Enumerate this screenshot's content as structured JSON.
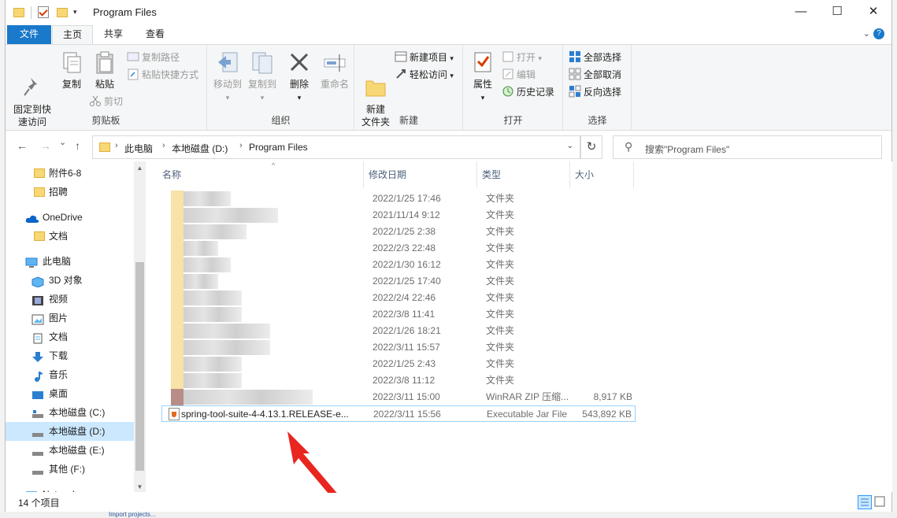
{
  "quick_access": {
    "dropdown": "▾"
  },
  "window": {
    "title": "Program Files",
    "minimize": "—",
    "maximize": "☐",
    "close": "✕"
  },
  "tabs": {
    "file": "文件",
    "home": "主页",
    "share": "共享",
    "view": "查看"
  },
  "ribbon": {
    "clipboard": {
      "pin": "固定到快\n速访问",
      "copy": "复制",
      "paste": "粘贴",
      "copy_path": "复制路径",
      "paste_shortcut": "粘贴快捷方式",
      "cut": "剪切",
      "label": "剪贴板"
    },
    "organize": {
      "move_to": "移动到",
      "copy_to": "复制到",
      "delete": "删除",
      "rename": "重命名",
      "label": "组织"
    },
    "new": {
      "new_folder": "新建\n文件夹",
      "new_item": "新建项目",
      "easy_access": "轻松访问",
      "label": "新建"
    },
    "open": {
      "properties": "属性",
      "open": "打开",
      "edit": "编辑",
      "history": "历史记录",
      "label": "打开"
    },
    "select": {
      "select_all": "全部选择",
      "select_none": "全部取消",
      "invert": "反向选择",
      "label": "选择"
    }
  },
  "nav": {
    "back": "←",
    "forward": "→",
    "up": "↑",
    "recent": "⌄",
    "refresh": "↻",
    "breadcrumb": [
      "此电脑",
      "本地磁盘 (D:)",
      "Program Files"
    ],
    "search_placeholder": "搜索\"Program Files\""
  },
  "sidebar": {
    "items": [
      {
        "label": "附件6-8",
        "icon": "folder-icon"
      },
      {
        "label": "招聘",
        "icon": "folder-icon"
      },
      {
        "label": "OneDrive",
        "icon": "cloud-icon"
      },
      {
        "label": "文档",
        "icon": "folder-icon"
      },
      {
        "label": "此电脑",
        "icon": "computer-icon"
      },
      {
        "label": "3D 对象",
        "icon": "cube-icon"
      },
      {
        "label": "视频",
        "icon": "video-icon"
      },
      {
        "label": "图片",
        "icon": "picture-icon"
      },
      {
        "label": "文档",
        "icon": "document-icon"
      },
      {
        "label": "下载",
        "icon": "download-icon"
      },
      {
        "label": "音乐",
        "icon": "music-icon"
      },
      {
        "label": "桌面",
        "icon": "desktop-icon"
      },
      {
        "label": "本地磁盘 (C:)",
        "icon": "drive-icon"
      },
      {
        "label": "本地磁盘 (D:)",
        "icon": "drive-icon"
      },
      {
        "label": "本地磁盘 (E:)",
        "icon": "drive-icon"
      },
      {
        "label": "其他 (F:)",
        "icon": "drive-icon"
      },
      {
        "label": "Network",
        "icon": "network-icon"
      }
    ]
  },
  "columns": {
    "name": "名称",
    "modified": "修改日期",
    "type": "类型",
    "size": "大小"
  },
  "files": [
    {
      "name": "",
      "date": "2022/1/25 17:46",
      "type": "文件夹",
      "size": ""
    },
    {
      "name": "",
      "date": "2021/11/14 9:12",
      "type": "文件夹",
      "size": ""
    },
    {
      "name": "",
      "date": "2022/1/25 2:38",
      "type": "文件夹",
      "size": ""
    },
    {
      "name": "",
      "date": "2022/2/3 22:48",
      "type": "文件夹",
      "size": ""
    },
    {
      "name": "",
      "date": "2022/1/30 16:12",
      "type": "文件夹",
      "size": ""
    },
    {
      "name": "",
      "date": "2022/1/25 17:40",
      "type": "文件夹",
      "size": ""
    },
    {
      "name": "",
      "date": "2022/2/4 22:46",
      "type": "文件夹",
      "size": ""
    },
    {
      "name": "",
      "date": "2022/3/8 11:41",
      "type": "文件夹",
      "size": ""
    },
    {
      "name": "",
      "date": "2022/1/26 18:21",
      "type": "文件夹",
      "size": ""
    },
    {
      "name": "",
      "date": "2022/3/11 15:57",
      "type": "文件夹",
      "size": ""
    },
    {
      "name": "",
      "date": "2022/1/25 2:43",
      "type": "文件夹",
      "size": ""
    },
    {
      "name": "",
      "date": "2022/3/8 11:12",
      "type": "文件夹",
      "size": ""
    },
    {
      "name": "",
      "date": "2022/3/11 15:00",
      "type": "WinRAR ZIP 压缩...",
      "size": "8,917 KB"
    },
    {
      "name": "spring-tool-suite-4-4.13.1.RELEASE-e...",
      "date": "2022/3/11 15:56",
      "type": "Executable Jar File",
      "size": "543,892 KB"
    }
  ],
  "status": {
    "count": "14 个项目"
  },
  "bottom": {
    "link": "Import projects..."
  },
  "colors": {
    "accent": "#1979ca",
    "selection": "#cce8ff",
    "arrow": "#e8251f"
  }
}
